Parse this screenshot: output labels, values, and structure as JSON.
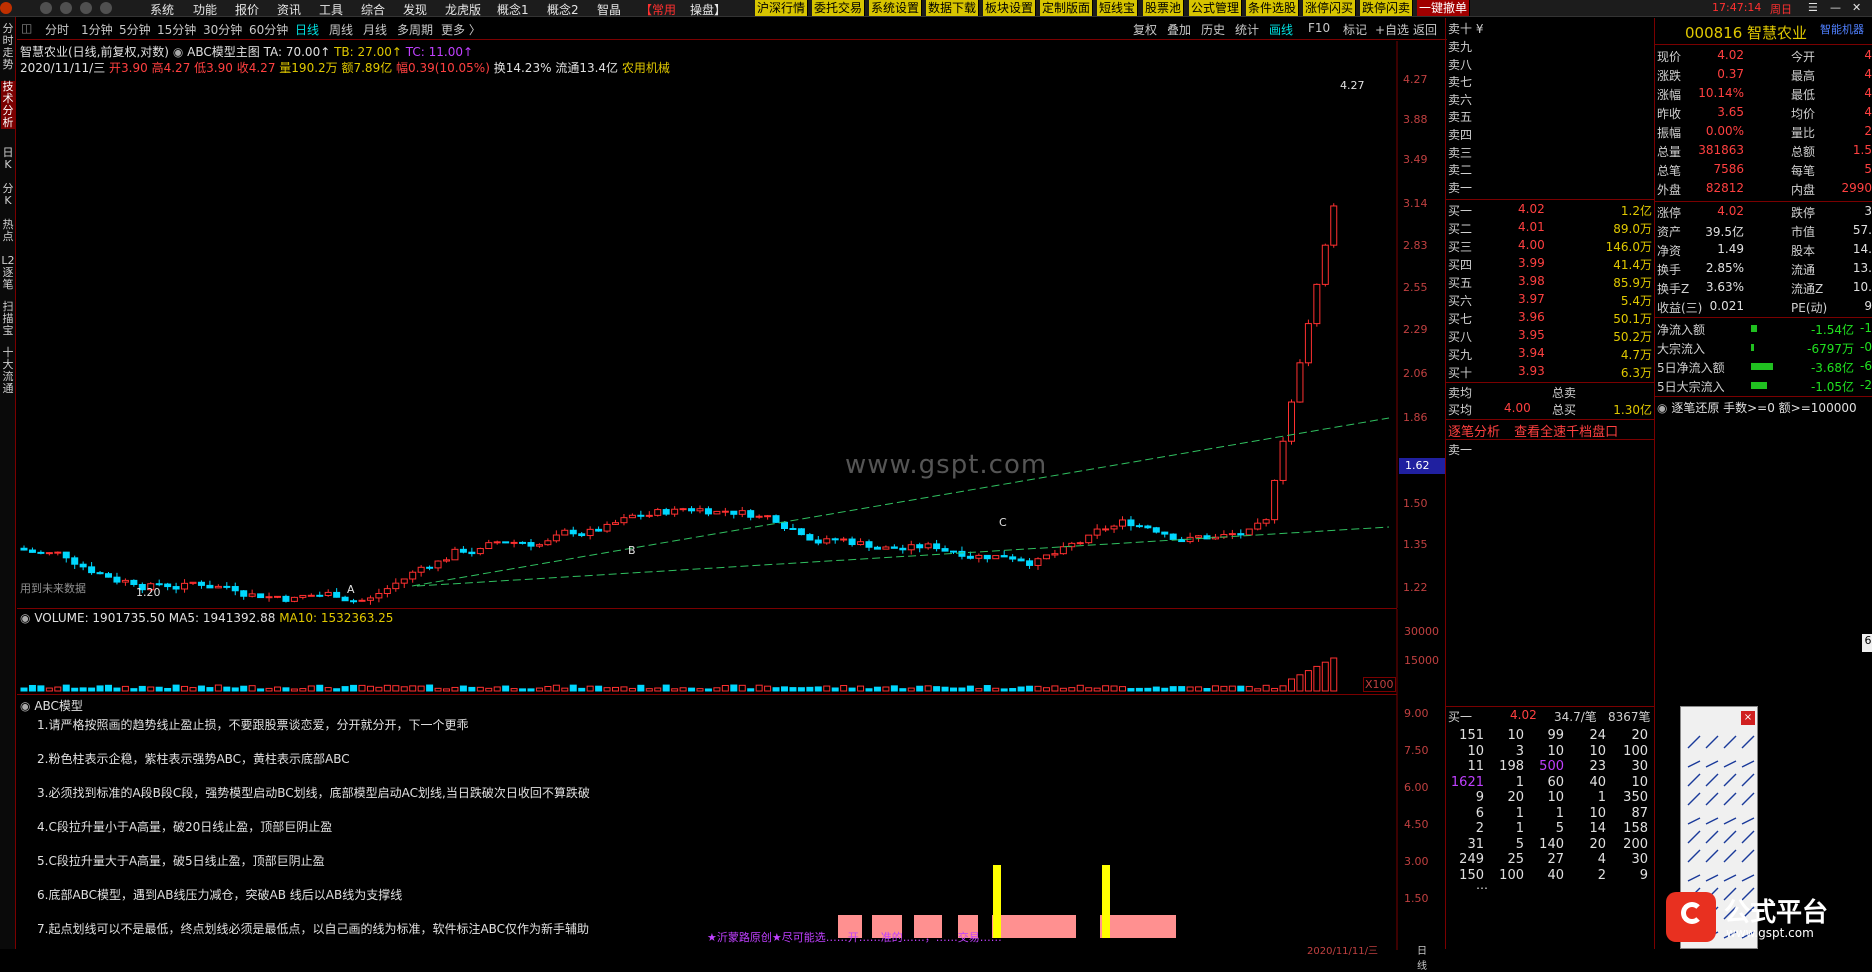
{
  "menubar": {
    "items": [
      "系统",
      "功能",
      "报价",
      "资讯",
      "工具",
      "综合",
      "发现",
      "龙虎版",
      "概念1",
      "概念2",
      "智晶"
    ],
    "common": "【常用",
    "op": "操盘】",
    "buttons": [
      "沪深行情",
      "委托交易",
      "系统设置",
      "数据下载",
      "板块设置",
      "定制版面",
      "短线宝",
      "股票池",
      "公式管理",
      "条件选股",
      "涨停闪买",
      "跌停闪卖",
      "一键撤单"
    ],
    "time": "17:47:14",
    "weekday": "周日"
  },
  "leftbar": {
    "tabs": [
      "分时走势",
      "技术分析",
      "日K",
      "分K",
      "热点",
      "L2逐笔",
      "扫描宝",
      "十大流通"
    ]
  },
  "timeframes": {
    "items": [
      "分时",
      "1分钟",
      "5分钟",
      "15分钟",
      "30分钟",
      "60分钟",
      "日线",
      "周线",
      "月线",
      "多周期",
      "更多 〉"
    ],
    "active": "日线"
  },
  "toolbar": {
    "items": [
      "复权",
      "叠加",
      "历史",
      "统计",
      "画线",
      "F10",
      "标记",
      "+自选",
      "返回"
    ]
  },
  "chart": {
    "title": "智慧农业(日线,前复权,对数)",
    "indicator_name": "ABC模型主图",
    "ta": "TA: 70.00↑",
    "tb": "TB: 27.00↑",
    "tc": "TC: 11.00↑",
    "date": "2020/11/11/三",
    "open": "开3.90",
    "high": "高4.27",
    "low": "低3.90",
    "close": "收4.27",
    "vol": "量190.2万",
    "amount": "额7.89亿",
    "change": "幅0.39(10.05%)",
    "turnover": "换14.23%",
    "float": "流通13.4亿",
    "sector": "农用机械",
    "note": "用到未来数据",
    "y_ticks": [
      "4.27",
      "3.88",
      "3.49",
      "3.14",
      "2.83",
      "2.55",
      "2.29",
      "2.06",
      "1.86",
      "1.62",
      "1.50",
      "1.35",
      "1.22"
    ],
    "current_price_tag": "1.62",
    "high_label": "4.27",
    "low_label": "1.20",
    "labels": {
      "A": "A",
      "B": "B",
      "C": "C"
    },
    "watermark": "www.gspt.com"
  },
  "volume": {
    "label": "VOLUME: 1901735.50",
    "ma5": "MA5: 1941392.88",
    "ma10": "MA10: 1532363.25",
    "y_ticks": [
      "30000",
      "15000"
    ],
    "unit": "X100"
  },
  "abc": {
    "title": "ABC模型",
    "lines": [
      "1.请严格按照画的趋势线止盈止损，不要跟股票谈恋爱，分开就分开，下一个更乖",
      "2.粉色柱表示企稳，紫柱表示强势ABC，黄柱表示底部ABC",
      "3.必须找到标准的A段B段C段，强势模型启动BC划线，底部模型启动AC划线,当日跌破次日收回不算跌破",
      "4.C段拉升量小于A高量，破20日线止盈，顶部巨阴止盈",
      "5.C段拉升量大于A高量，破5日线止盈，顶部巨阴止盈",
      "6.底部ABC模型，遇到AB线压力减仓，突破AB 线后以AB线为支撑线",
      "7.起点划线可以不是最低，终点划线必须是最低点，以自己画的线为标准，软件标注ABC仅作为新手辅助"
    ],
    "y_ticks": [
      "9.00",
      "7.50",
      "6.00",
      "4.50",
      "3.00",
      "1.50"
    ],
    "footer": "★沂蒙路原创★尽可能选……开……准的……，……交易……",
    "bottom_date": "2020/11/11/三",
    "bottom_right": "日线"
  },
  "orderbook": {
    "header": "卖十 ¥",
    "sell": [
      "卖九",
      "卖八",
      "卖七",
      "卖六",
      "卖五",
      "卖四",
      "卖三",
      "卖二",
      "卖一"
    ],
    "buy": [
      {
        "label": "买一",
        "price": "4.02",
        "vol": "1.2亿"
      },
      {
        "label": "买二",
        "price": "4.01",
        "vol": "89.0万"
      },
      {
        "label": "买三",
        "price": "4.00",
        "vol": "146.0万"
      },
      {
        "label": "买四",
        "price": "3.99",
        "vol": "41.4万"
      },
      {
        "label": "买五",
        "price": "3.98",
        "vol": "85.9万"
      },
      {
        "label": "买六",
        "price": "3.97",
        "vol": "5.4万"
      },
      {
        "label": "买七",
        "price": "3.96",
        "vol": "50.1万"
      },
      {
        "label": "买八",
        "price": "3.95",
        "vol": "50.2万"
      },
      {
        "label": "买九",
        "price": "3.94",
        "vol": "4.7万"
      },
      {
        "label": "买十",
        "price": "3.93",
        "vol": "6.3万"
      }
    ],
    "avg_sell_label": "卖均",
    "total_sell_label": "总卖",
    "avg_buy_label": "买均",
    "avg_buy": "4.00",
    "total_buy_label": "总买",
    "total_buy": "1.30亿",
    "tab1": "逐笔分析",
    "tab2": "查看全速千档盘口",
    "sell1_label": "卖一",
    "queue_header": {
      "label": "买一",
      "price": "4.02",
      "avg": "34.7/笔",
      "count": "8367笔"
    },
    "queue": [
      [
        "151",
        "10",
        "99",
        "24",
        "20"
      ],
      [
        "10",
        "3",
        "10",
        "10",
        "100"
      ],
      [
        "11",
        "198",
        "500",
        "23",
        "30"
      ],
      [
        "1621",
        "1",
        "60",
        "40",
        "10"
      ],
      [
        "9",
        "20",
        "10",
        "1",
        "350"
      ],
      [
        "6",
        "1",
        "1",
        "10",
        "87"
      ],
      [
        "2",
        "1",
        "5",
        "14",
        "158"
      ],
      [
        "31",
        "5",
        "140",
        "20",
        "200"
      ],
      [
        "249",
        "25",
        "27",
        "4",
        "30"
      ],
      [
        "150",
        "100",
        "40",
        "2",
        "9"
      ]
    ],
    "queue_more": "…"
  },
  "quote": {
    "code_name": "000816 智慧农业",
    "tag": "智能机器",
    "rows": [
      {
        "l1": "现价",
        "v1": "4.02",
        "l2": "今开",
        "v2": "4"
      },
      {
        "l1": "涨跌",
        "v1": "0.37",
        "l2": "最高",
        "v2": "4"
      },
      {
        "l1": "涨幅",
        "v1": "10.14%",
        "l2": "最低",
        "v2": "4"
      },
      {
        "l1": "昨收",
        "v1": "3.65",
        "l2": "均价",
        "v2": "4"
      },
      {
        "l1": "振幅",
        "v1": "0.00%",
        "l2": "量比",
        "v2": "2"
      },
      {
        "l1": "总量",
        "v1": "381863",
        "l2": "总额",
        "v2": "1.5"
      },
      {
        "l1": "总笔",
        "v1": "7586",
        "l2": "每笔",
        "v2": "5"
      },
      {
        "l1": "外盘",
        "v1": "82812",
        "l2": "内盘",
        "v2": "2990"
      }
    ],
    "rows2": [
      {
        "l1": "涨停",
        "v1": "4.02",
        "l2": "跌停",
        "v2": "3"
      },
      {
        "l1": "资产",
        "v1": "39.5亿",
        "l2": "市值",
        "v2": "57."
      },
      {
        "l1": "净资",
        "v1": "1.49",
        "l2": "股本",
        "v2": "14."
      },
      {
        "l1": "换手",
        "v1": "2.85%",
        "l2": "流通",
        "v2": "13."
      },
      {
        "l1": "换手Z",
        "v1": "3.63%",
        "l2": "流通Z",
        "v2": "10."
      },
      {
        "l1": "收益(三)",
        "v1": "0.021",
        "l2": "PE(动)",
        "v2": "9"
      }
    ],
    "flows": [
      {
        "label": "净流入额",
        "value": "-1.54亿",
        "tail": "-1"
      },
      {
        "label": "大宗流入",
        "value": "-6797万",
        "tail": "-0"
      },
      {
        "label": "5日净流入额",
        "value": "-3.68亿",
        "tail": "-6"
      },
      {
        "label": "5日大宗流入",
        "value": "-1.05亿",
        "tail": "-2"
      }
    ],
    "filter": "逐笔还原  手数>=0 额>=100000",
    "side_tab": "6"
  },
  "logo": {
    "text": "公式平台",
    "url": "www.gspt.com"
  },
  "toolbox": {
    "close": "×"
  },
  "colors": {
    "up": "#ff3030",
    "down": "#00d8ff",
    "accent": "#7a0000",
    "yellow": "#e0c800"
  }
}
